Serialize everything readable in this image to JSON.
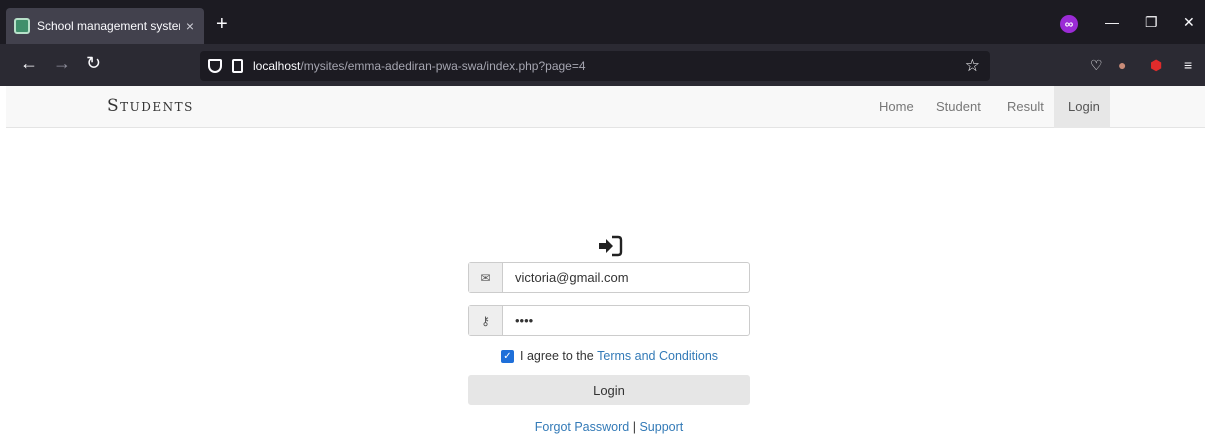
{
  "browser": {
    "tab_title": "School management system",
    "tab_close": "×",
    "new_tab": "+",
    "url_host": "localhost",
    "url_path": "/mysites/emma-adediran-pwa-swa/index.php?page=4",
    "icons": {
      "back": "back-arrow-icon",
      "forward": "forward-arrow-icon",
      "reload": "reload-icon",
      "bookmark": "star-icon",
      "pocket": "pocket-icon",
      "account": "account-icon",
      "extension": "extension-icon",
      "menu": "hamburger-menu-icon",
      "private_browsing": "mask-icon"
    }
  },
  "site": {
    "brand": "Students",
    "nav": [
      {
        "label": "Home",
        "active": false
      },
      {
        "label": "Student",
        "active": false
      },
      {
        "label": "Result",
        "active": false
      },
      {
        "label": "Login",
        "active": true
      }
    ]
  },
  "login": {
    "icon": "sign-in-icon",
    "email_icon": "envelope-icon",
    "password_icon": "key-icon",
    "email_value": "victoria@gmail.com",
    "password_value": "••••",
    "terms_checked": true,
    "terms_prefix": "I agree to the ",
    "terms_link": "Terms and Conditions",
    "button_label": "Login",
    "forgot_label": "Forgot Password",
    "separator": "|",
    "support_label": "Support"
  },
  "colors": {
    "browser_dark": "#1c1b22",
    "browser_toolbar": "#2b2a33",
    "link": "#337ab7",
    "checkbox": "#1e6fd9",
    "navbar_bg": "#f8f8f8"
  }
}
